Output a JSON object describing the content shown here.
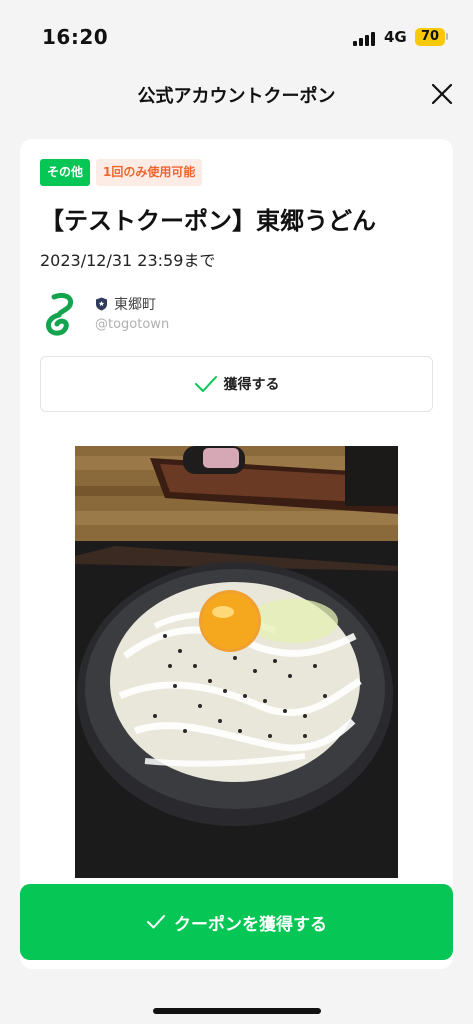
{
  "status_bar": {
    "time": "16:20",
    "network": "4G",
    "battery": "70"
  },
  "header": {
    "title": "公式アカウントクーポン"
  },
  "coupon": {
    "tags": [
      "その他",
      "1回のみ使用可能"
    ],
    "title": "【テストクーポン】東郷うどん",
    "expiry": "2023/12/31 23:59まで",
    "account": {
      "name": "東郷町",
      "id": "@togotown"
    },
    "acquire_label": "獲得する"
  },
  "footer": {
    "cta_label": "クーポンを獲得する"
  },
  "colors": {
    "brand_green": "#06c755",
    "tag_orange_text": "#ee6530",
    "battery_yellow": "#f7c909"
  },
  "icons": [
    "signal-icon",
    "battery-icon",
    "close-icon",
    "shield-icon",
    "check-icon"
  ]
}
